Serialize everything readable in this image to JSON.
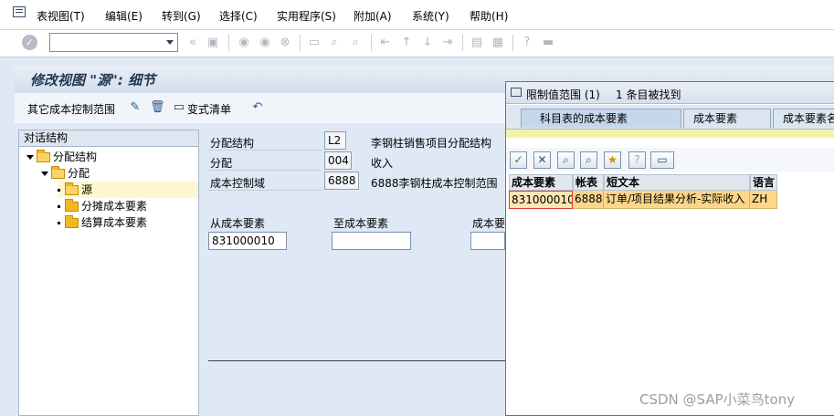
{
  "menubar": {
    "items": [
      "表视图(T)",
      "编辑(E)",
      "转到(G)",
      "选择(C)",
      "实用程序(S)",
      "附加(A)",
      "系统(Y)",
      "帮助(H)"
    ]
  },
  "toolbar": {
    "command_field_value": ""
  },
  "main": {
    "title": "修改视图 \"源\": 细节",
    "app_toolbar": {
      "other_area_label": "其它成本控制范围",
      "change_list_label": "变式清单"
    }
  },
  "tree": {
    "header": "对话结构",
    "items": [
      "分配结构",
      "分配",
      "源",
      "分摊成本要素",
      "结算成本要素"
    ]
  },
  "form": {
    "alloc_structure": {
      "label": "分配结构",
      "value": "L2",
      "desc": "李钢柱销售项目分配结构"
    },
    "allocation": {
      "label": "分配",
      "value": "004",
      "desc": "收入"
    },
    "controlling_area": {
      "label": "成本控制域",
      "value": "6888",
      "desc": "6888李钢柱成本控制范围"
    },
    "from_ce": {
      "label": "从成本要素",
      "value": "831000010"
    },
    "to_ce": {
      "label": "至成本要素",
      "value": ""
    },
    "ce_group": {
      "label": "成本要",
      "value": ""
    }
  },
  "dialog": {
    "title": "限制值范围 (1)",
    "count": "1 条目被找到",
    "tabs": [
      "科目表的成本要素",
      "成本要素",
      "成本要素名"
    ],
    "columns": [
      "成本要素",
      "帐表",
      "短文本",
      "语言"
    ],
    "rows": [
      {
        "cost_element": "831000010",
        "chart": "6888",
        "text": "订单/项目结果分析-实际收入",
        "lang": "ZH"
      }
    ]
  },
  "watermark": "CSDN @SAP小菜鸟tony",
  "colors": {
    "title_text": "#243651",
    "selected_row": "#fcd68a",
    "tree_selected": "#fff7cd",
    "folder": "#f3b81f"
  }
}
